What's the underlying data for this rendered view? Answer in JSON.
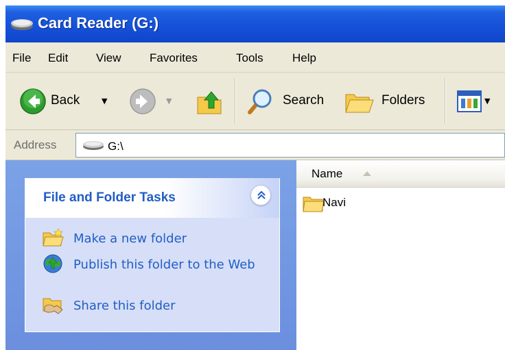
{
  "window": {
    "title": "Card Reader (G:)"
  },
  "menu": {
    "items": [
      "File",
      "Edit",
      "View",
      "Favorites",
      "Tools",
      "Help"
    ]
  },
  "toolbar": {
    "back_label": "Back",
    "search_label": "Search",
    "folders_label": "Folders"
  },
  "address": {
    "label": "Address",
    "value": "G:\\"
  },
  "tasks": {
    "title": "File and Folder Tasks",
    "items": [
      {
        "label": "Make a new folder",
        "icon": "new-folder-icon"
      },
      {
        "label": "Publish this folder to the Web",
        "icon": "publish-web-icon"
      },
      {
        "label": "Share this folder",
        "icon": "share-folder-icon"
      }
    ]
  },
  "filelist": {
    "column_name": "Name",
    "items": [
      {
        "name": "Navi",
        "icon": "folder-icon"
      }
    ]
  },
  "colors": {
    "titlebar": "#1550d8",
    "chrome": "#ece9d8",
    "taskpane": "#7ba2e7",
    "task_link": "#215dc6"
  }
}
